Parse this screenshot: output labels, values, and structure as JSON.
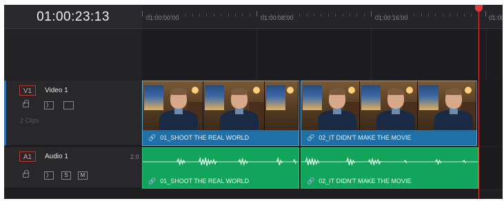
{
  "timeline": {
    "timecode": "01:00:23:13",
    "ruler_labels": [
      "01:00:00:00",
      "01:00:08:00",
      "01:00:16:00",
      "01:00"
    ]
  },
  "tracks": {
    "video": {
      "badge": "V1",
      "name": "Video 1",
      "clip_count": "2 Clips",
      "icons": [
        "lock-icon",
        "auto-select-icon",
        "monitor-icon"
      ]
    },
    "audio": {
      "badge": "A1",
      "name": "Audio 1",
      "level": "2.0",
      "solo": "S",
      "mute": "M",
      "icons": [
        "lock-icon",
        "auto-select-icon"
      ]
    }
  },
  "clips": {
    "video": [
      {
        "name": "01_SHOOT THE REAL WORLD"
      },
      {
        "name": "02_IT DIDN'T MAKE THE MOVIE"
      }
    ],
    "audio": [
      {
        "name": "01_SHOOT THE REAL WORLD"
      },
      {
        "name": "02_IT DIDN'T MAKE THE MOVIE"
      }
    ]
  },
  "colors": {
    "video_track_accent": "#2c6db3",
    "video_clip": "#1e72ad",
    "audio_clip": "#12a45a",
    "playhead": "#e23a3a",
    "badge_border": "#b23a3a"
  },
  "link_icon": "link-icon"
}
